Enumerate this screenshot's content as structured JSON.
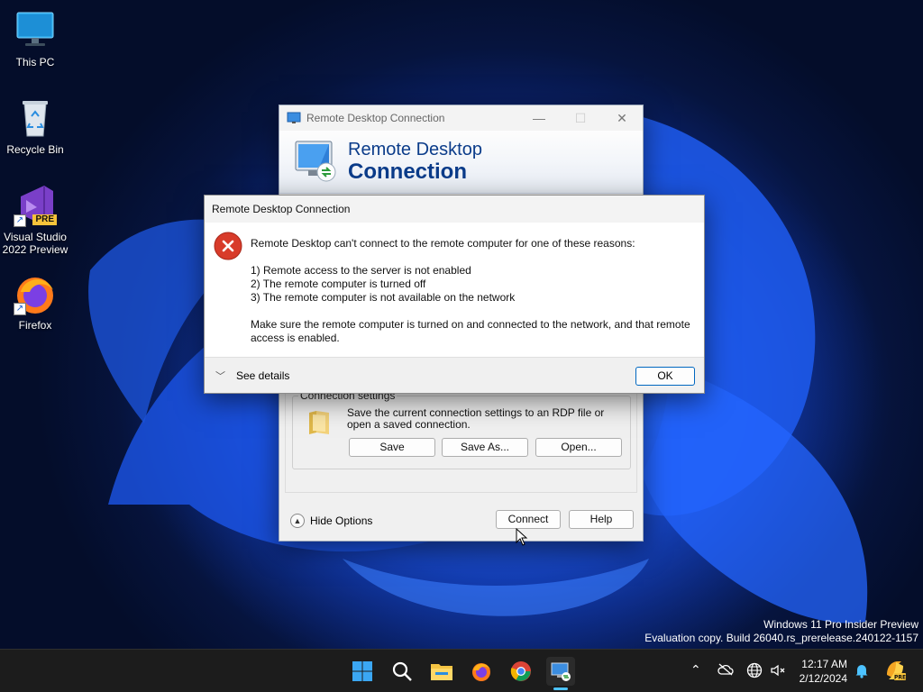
{
  "desktop": {
    "icons": [
      {
        "label": "This PC",
        "icon": "monitor-icon"
      },
      {
        "label": "Recycle Bin",
        "icon": "recycle-bin-icon"
      },
      {
        "label": "Visual Studio 2022 Preview",
        "icon": "visual-studio-icon",
        "badge": "PRE"
      },
      {
        "label": "Firefox",
        "icon": "firefox-icon"
      }
    ],
    "watermark": {
      "line1": "Windows 11 Pro Insider Preview",
      "line2": "Evaluation copy. Build 26040.rs_prerelease.240122-1157"
    }
  },
  "rdc_window": {
    "title": "Remote Desktop Connection",
    "banner_line1": "Remote Desktop",
    "banner_line2": "Connection",
    "connection_settings": {
      "legend": "Connection settings",
      "description": "Save the current connection settings to an RDP file or open a saved connection.",
      "save_label": "Save",
      "save_as_label": "Save As...",
      "open_label": "Open..."
    },
    "hide_options_label": "Hide Options",
    "connect_label": "Connect",
    "help_label": "Help"
  },
  "error_dialog": {
    "title": "Remote Desktop Connection",
    "intro": "Remote Desktop can't connect to the remote computer for one of these reasons:",
    "reasons": [
      "1) Remote access to the server is not enabled",
      "2) The remote computer is turned off",
      "3) The remote computer is not available on the network"
    ],
    "advice": "Make sure the remote computer is turned on and connected to the network, and that remote access is enabled.",
    "see_details_label": "See details",
    "ok_label": "OK"
  },
  "taskbar": {
    "pinned": [
      "start-icon",
      "search-icon",
      "file-explorer-icon",
      "firefox-icon",
      "chrome-icon",
      "remote-desktop-icon"
    ],
    "time": "12:17 AM",
    "date": "2/12/2024"
  },
  "colors": {
    "accent": "#0067c0",
    "error_red": "#d83b2a",
    "banner_text": "#0b3c8a"
  }
}
